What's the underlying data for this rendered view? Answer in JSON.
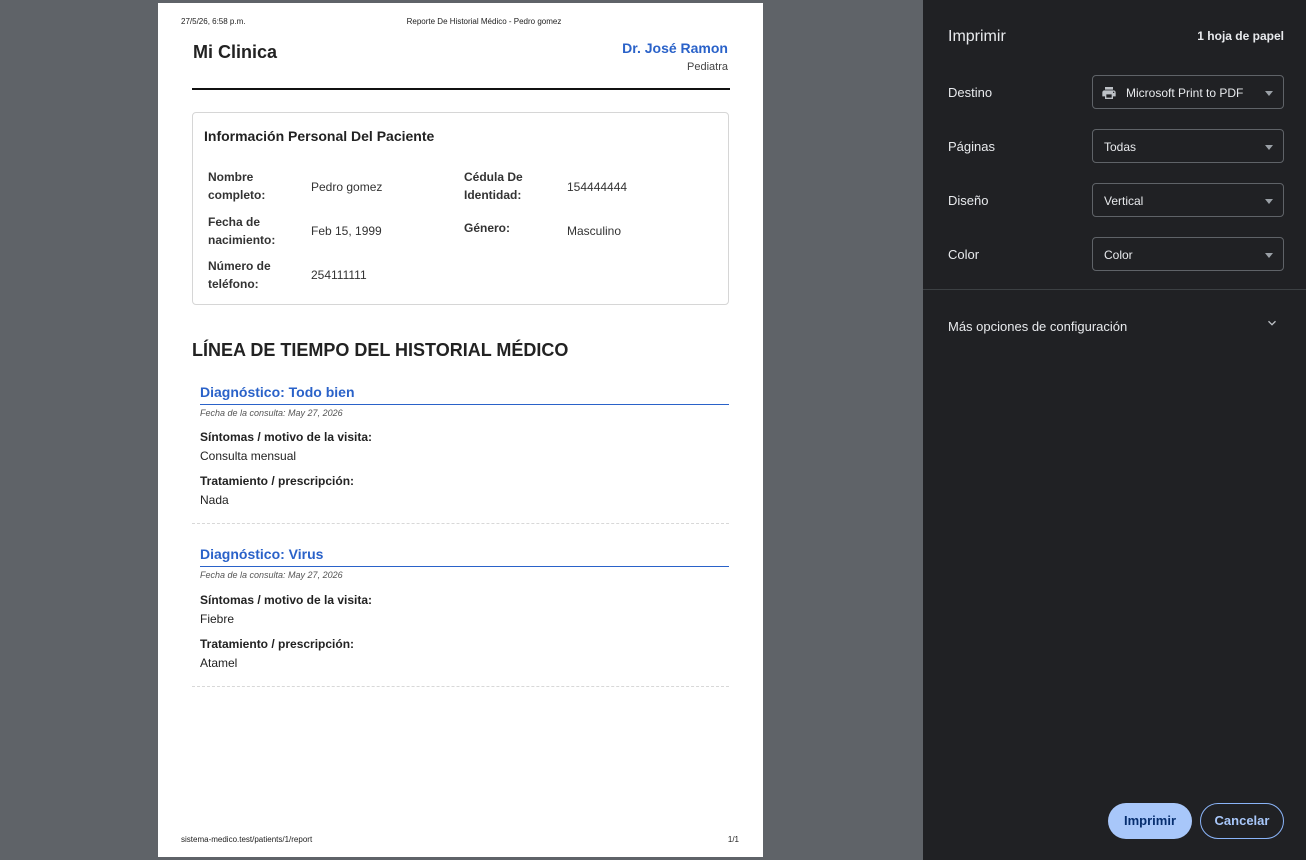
{
  "page": {
    "header_date": "27/5/26, 6:58 p.m.",
    "header_title": "Reporte De Historial Médico - Pedro gomez",
    "footer_url": "sistema-medico.test/patients/1/report",
    "footer_page": "1/1"
  },
  "report": {
    "clinic": "Mi Clinica",
    "doctor": "Dr. José Ramon",
    "specialty": "Pediatra",
    "info_title": "Información Personal Del Paciente",
    "fields": {
      "full_name_label": "Nombre completo:",
      "full_name": "Pedro gomez",
      "id_label": "Cédula De Identidad:",
      "id": "154444444",
      "dob_label": "Fecha de nacimiento:",
      "dob": "Feb 15, 1999",
      "gender_label": "Género:",
      "gender": "Masculino",
      "phone_label": "Número de teléfono:",
      "phone": "254111111"
    },
    "timeline_title": "LÍNEA DE TIEMPO DEL HISTORIAL MÉDICO",
    "entries": [
      {
        "diagnosis": "Diagnóstico: Todo bien",
        "date": "Fecha de la consulta: May 27, 2026",
        "symptoms_label": "Síntomas / motivo de la visita:",
        "symptoms": "Consulta mensual",
        "treatment_label": "Tratamiento / prescripción:",
        "treatment": "Nada"
      },
      {
        "diagnosis": "Diagnóstico: Virus",
        "date": "Fecha de la consulta: May 27, 2026",
        "symptoms_label": "Síntomas / motivo de la visita:",
        "symptoms": "Fiebre",
        "treatment_label": "Tratamiento / prescripción:",
        "treatment": "Atamel"
      }
    ]
  },
  "panel": {
    "title": "Imprimir",
    "sheets": "1 hoja de papel",
    "destination_label": "Destino",
    "destination_value": "Microsoft Print to PDF",
    "pages_label": "Páginas",
    "pages_value": "Todas",
    "layout_label": "Diseño",
    "layout_value": "Vertical",
    "color_label": "Color",
    "color_value": "Color",
    "more_options": "Más opciones de configuración",
    "print_button": "Imprimir",
    "cancel_button": "Cancelar"
  },
  "colors": {
    "accent": "#2a62c9",
    "panel_bg": "#202124",
    "print_button_bg": "#a8c7fa"
  },
  "icons": [
    "printer-icon",
    "chevron-down-icon"
  ]
}
